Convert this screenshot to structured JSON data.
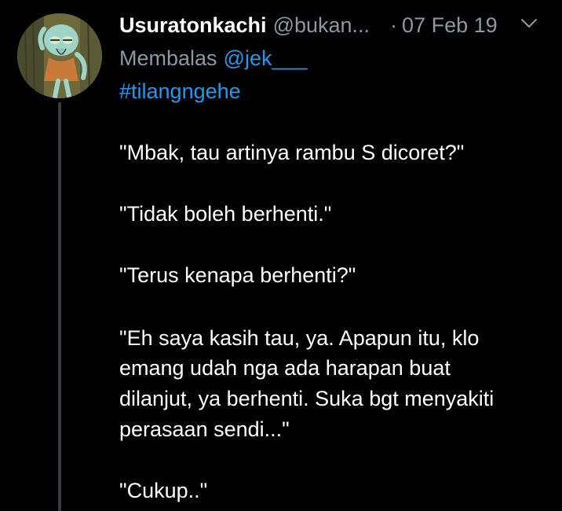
{
  "tweet": {
    "display_name": "Usuratonkachi",
    "handle": "@bukan...",
    "separator": "·",
    "date": "07 Feb 19",
    "reply_prefix": "Membalas",
    "reply_to": "@jek___",
    "hashtag": "#tilangngehe",
    "lines": [
      "\"Mbak, tau artinya rambu S dicoret?\"",
      "\"Tidak boleh berhenti.\"",
      "\"Terus kenapa berhenti?\"",
      "\"Eh saya kasih tau, ya. Apapun itu, klo",
      "emang udah nga ada harapan buat",
      "dilanjut, ya berhenti. Suka bgt menyakiti",
      "perasaan sendi...\"",
      "\"Cukup..\""
    ]
  },
  "icons": {
    "menu": "chevron-down-icon",
    "avatar": "avatar"
  },
  "colors": {
    "background": "#000000",
    "text": "#ffffff",
    "muted": "#8b98a5",
    "link": "#1d9bf0",
    "thread_line": "#3a3d40"
  }
}
